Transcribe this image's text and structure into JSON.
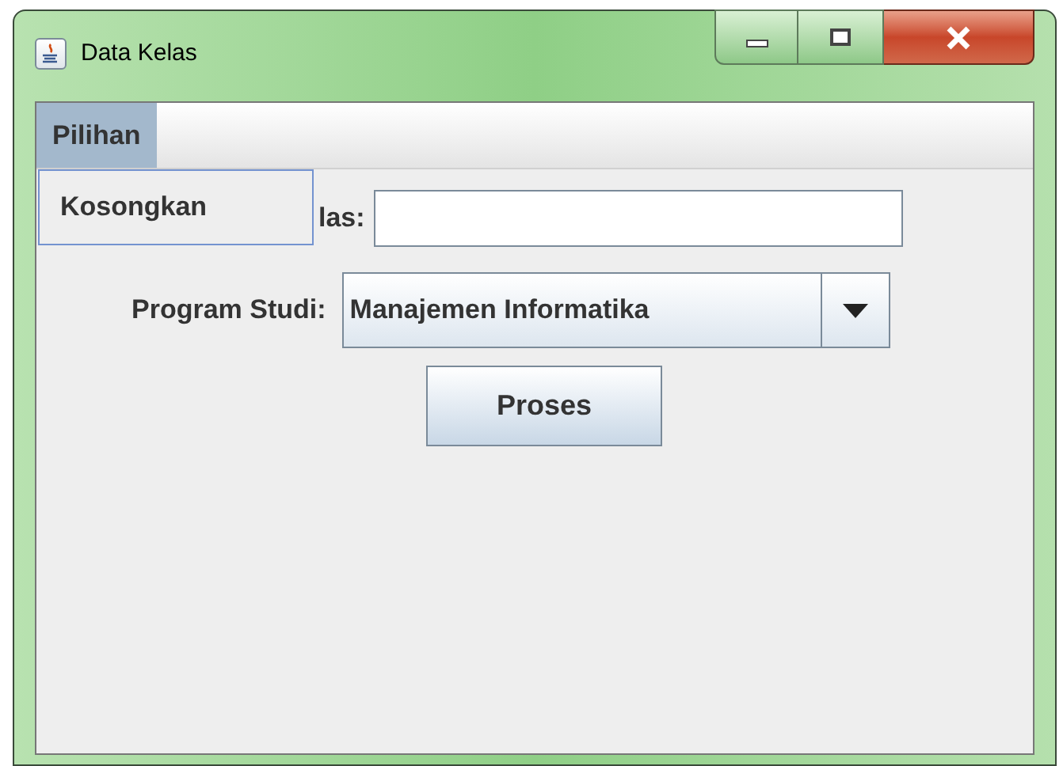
{
  "window": {
    "title": "Data Kelas"
  },
  "menu_bar": [
    {
      "label": "Pilihan",
      "selected": true
    }
  ],
  "menu_popup": {
    "items": [
      {
        "label": "Kosongkan"
      }
    ]
  },
  "form": {
    "kelas_label": "las:",
    "program_label": "Program Studi:",
    "program_value": "Manajemen Informatika",
    "button": "Proses"
  }
}
